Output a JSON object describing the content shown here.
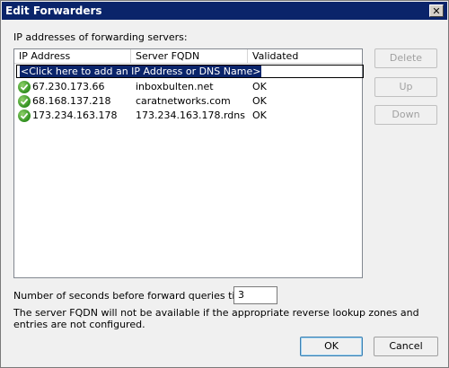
{
  "window": {
    "title": "Edit Forwarders",
    "close_icon": "close-icon"
  },
  "servers": {
    "label": "IP addresses of forwarding servers:",
    "columns": [
      "IP Address",
      "Server FQDN",
      "Validated"
    ],
    "add_prompt": "<Click here to add an IP Address or DNS Name>",
    "rows": [
      {
        "ip": "67.230.173.66",
        "fqdn": "inboxbulten.net",
        "validated": "OK",
        "icon": "check-icon"
      },
      {
        "ip": "68.168.137.218",
        "fqdn": "caratnetworks.com",
        "validated": "OK",
        "icon": "check-icon"
      },
      {
        "ip": "173.234.163.178",
        "fqdn": "173.234.163.178.rdns....",
        "validated": "OK",
        "icon": "check-icon"
      }
    ]
  },
  "buttons": {
    "delete": "Delete",
    "up": "Up",
    "down": "Down",
    "ok": "OK",
    "cancel": "Cancel"
  },
  "timeout": {
    "label": "Number of seconds before forward queries time out:",
    "value": "3"
  },
  "note": "The server FQDN will not be available if the appropriate reverse lookup zones and entries are not configured.",
  "colors": {
    "titlebar": "#0a246a",
    "selection": "#0a246a",
    "check": "#2f8f1e"
  }
}
